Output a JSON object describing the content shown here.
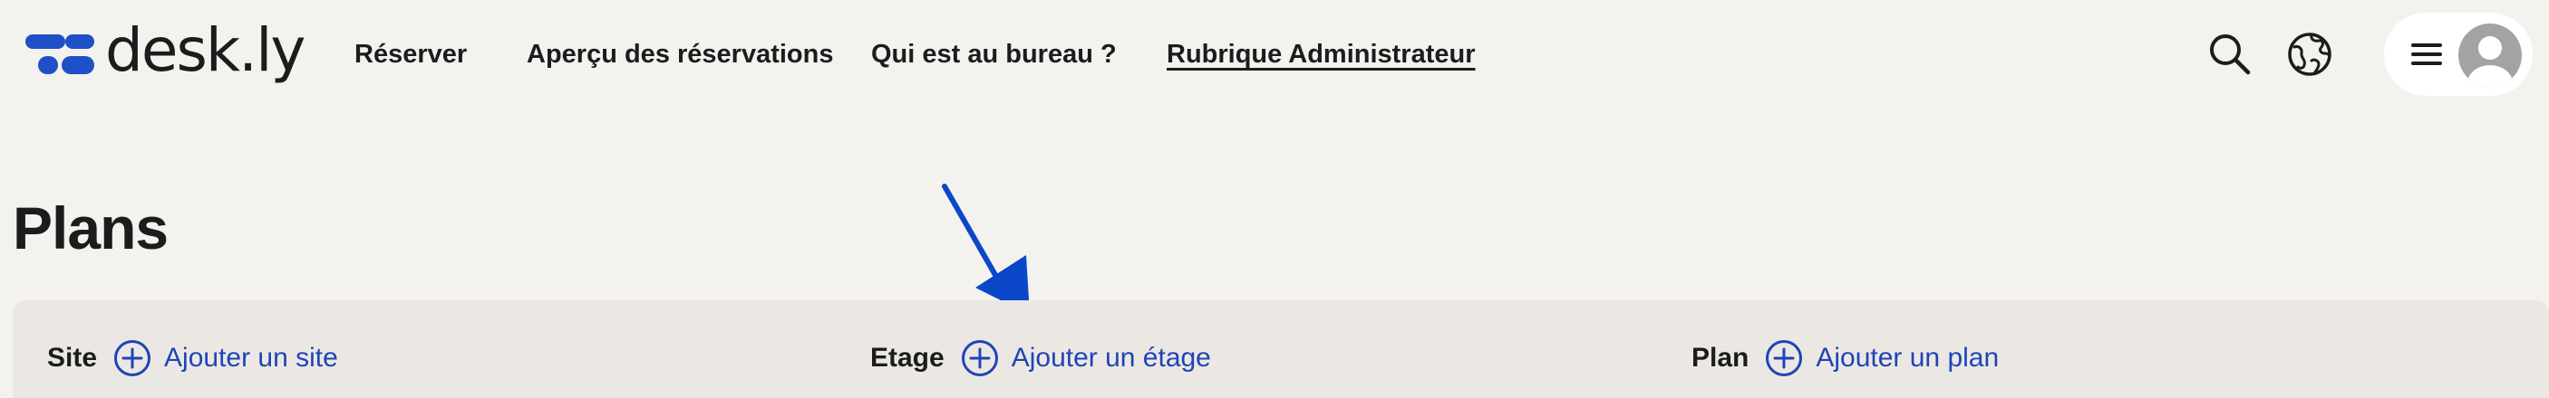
{
  "brand": {
    "name": "desk.ly",
    "color": "#1f50c7"
  },
  "nav": {
    "items": [
      {
        "label": "Réserver",
        "active": false
      },
      {
        "label": "Aperçu des réservations",
        "active": false
      },
      {
        "label": "Qui est au bureau ?",
        "active": false
      },
      {
        "label": "Rubrique Administrateur",
        "active": true
      }
    ]
  },
  "header_icons": {
    "search": "search-icon",
    "language": "globe-icon",
    "menu": "hamburger-menu-icon",
    "avatar": "user-avatar-icon"
  },
  "page": {
    "title": "Plans"
  },
  "filters": {
    "site": {
      "label": "Site",
      "add_label": "Ajouter un site"
    },
    "etage": {
      "label": "Etage",
      "add_label": "Ajouter un étage"
    },
    "plan": {
      "label": "Plan",
      "add_label": "Ajouter un plan"
    }
  },
  "annotation": {
    "arrow_color": "#0a47c9"
  },
  "colors": {
    "background": "#f4f2ef",
    "panel": "#ebe8e4",
    "link": "#1f44b8"
  }
}
